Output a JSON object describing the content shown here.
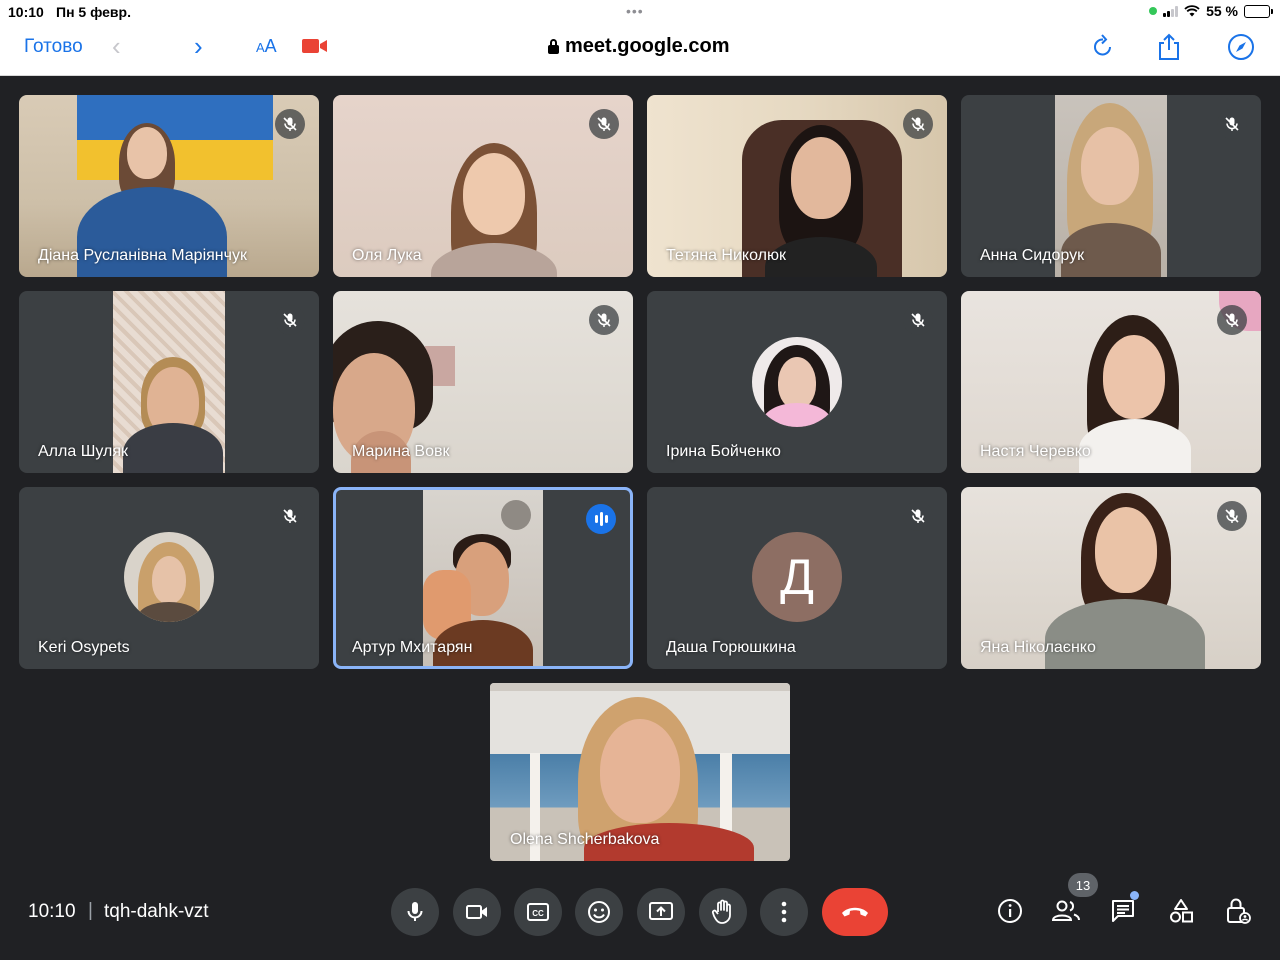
{
  "status_bar": {
    "time": "10:10",
    "date": "Пн 5 февр.",
    "battery": "55 %"
  },
  "browser": {
    "done_label": "Готово",
    "text_size_label": "AA",
    "text_size_small": "A",
    "url": "meet.google.com"
  },
  "participants": [
    {
      "name": "Діана Русланівна Маріянчук",
      "muted": true
    },
    {
      "name": "Оля Лука",
      "muted": true
    },
    {
      "name": "Тетяна Николюк",
      "muted": true
    },
    {
      "name": "Анна Сидорук",
      "muted": true
    },
    {
      "name": "Алла Шуляк",
      "muted": true
    },
    {
      "name": "Марина Вовк",
      "muted": true
    },
    {
      "name": "Ірина Бойченко",
      "muted": true
    },
    {
      "name": "Настя Черевко",
      "muted": true
    },
    {
      "name": "Keri Osypets",
      "muted": true
    },
    {
      "name": "Артур Мхитарян",
      "muted": false,
      "speaking": true
    },
    {
      "name": "Даша Горюшкина",
      "muted": true,
      "avatar_letter": "Д"
    },
    {
      "name": "Яна Ніколаєнко",
      "muted": true
    },
    {
      "name": "Olena Shcherbakova",
      "muted": false
    }
  ],
  "meeting": {
    "time": "10:10",
    "separator": "|",
    "code": "tqh-dahk-vzt",
    "participant_count": "13"
  },
  "colors": {
    "background": "#202124",
    "tile": "#3c4043",
    "end_call": "#ea4335",
    "speaking_border": "#8ab4f8",
    "accent": "#1a73e8"
  }
}
